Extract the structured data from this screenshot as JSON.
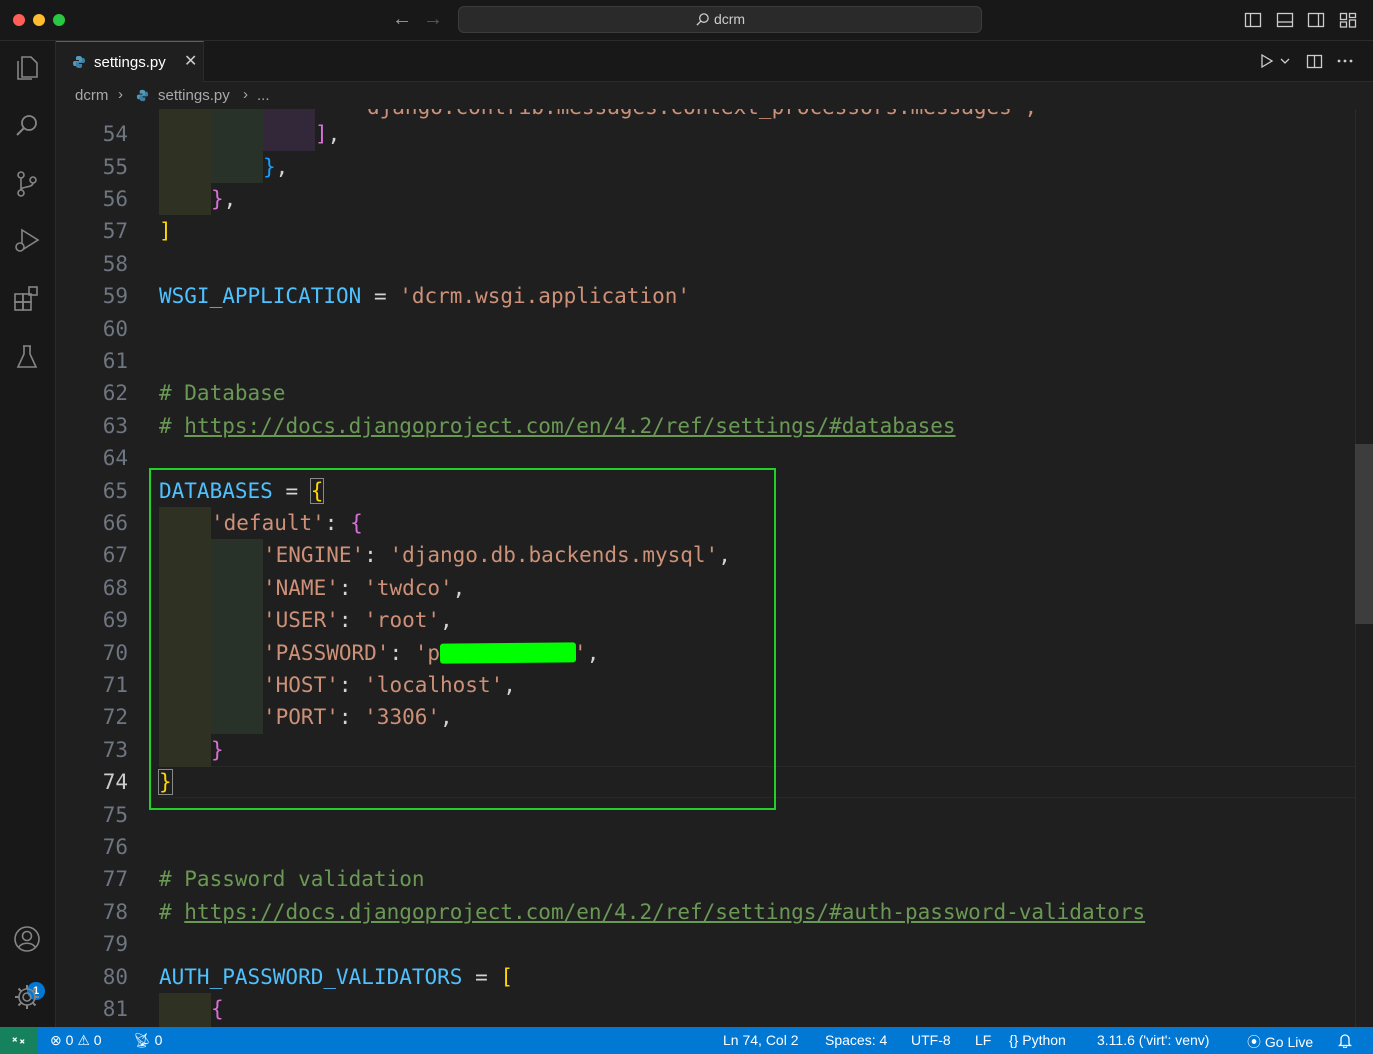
{
  "titlebar": {
    "search_text": "dcrm"
  },
  "tab": {
    "label": "settings.py"
  },
  "breadcrumb": {
    "folder": "dcrm",
    "file": "settings.py",
    "more": "..."
  },
  "editor": {
    "lines": [
      {
        "n": "54"
      },
      {
        "n": "55"
      },
      {
        "n": "56"
      },
      {
        "n": "57"
      },
      {
        "n": "58"
      },
      {
        "n": "59"
      },
      {
        "n": "60"
      },
      {
        "n": "61"
      },
      {
        "n": "62"
      },
      {
        "n": "63"
      },
      {
        "n": "64"
      },
      {
        "n": "65"
      },
      {
        "n": "66"
      },
      {
        "n": "67"
      },
      {
        "n": "68"
      },
      {
        "n": "69"
      },
      {
        "n": "70"
      },
      {
        "n": "71"
      },
      {
        "n": "72"
      },
      {
        "n": "73"
      },
      {
        "n": "74"
      },
      {
        "n": "75"
      },
      {
        "n": "76"
      },
      {
        "n": "77"
      },
      {
        "n": "78"
      },
      {
        "n": "79"
      },
      {
        "n": "80"
      },
      {
        "n": "81"
      }
    ],
    "code": {
      "wsgi_name": "WSGI_APPLICATION",
      "wsgi_value": "'dcrm.wsgi.application'",
      "db_comment": "# Database",
      "db_link_hash": "# ",
      "db_link": "https://docs.djangoproject.com/en/4.2/ref/settings/#databases",
      "databases": "DATABASES",
      "default_key": "'default'",
      "engine_key": "'ENGINE'",
      "engine_val": "'django.db.backends.mysql'",
      "name_key": "'NAME'",
      "name_val": "'twdco'",
      "user_key": "'USER'",
      "user_val": "'root'",
      "password_key": "'PASSWORD'",
      "password_val": "'p",
      "password_end": "'",
      "host_key": "'HOST'",
      "host_val": "'localhost'",
      "port_key": "'PORT'",
      "port_val": "'3306'",
      "pw_comment": "# Password validation",
      "pw_link": "https://docs.djangoproject.com/en/4.2/ref/settings/#auth-password-validators",
      "validators": "AUTH_PASSWORD_VALIDATORS",
      "cut_line": "django.contrib.messages.context_processors.messages',"
    }
  },
  "activity": {
    "account_badge": "1"
  },
  "statusbar": {
    "errors": "0",
    "warnings": "0",
    "ports": "0",
    "cursor": "Ln 74, Col 2",
    "spaces": "Spaces: 4",
    "encoding": "UTF-8",
    "eol": "LF",
    "language": "Python",
    "interpreter": "3.11.6 ('virt': venv)",
    "golive": "Go Live"
  },
  "colors": {
    "accent": "#0078d4",
    "highlight_box": "#22d02a",
    "redaction": "#00ff00"
  }
}
